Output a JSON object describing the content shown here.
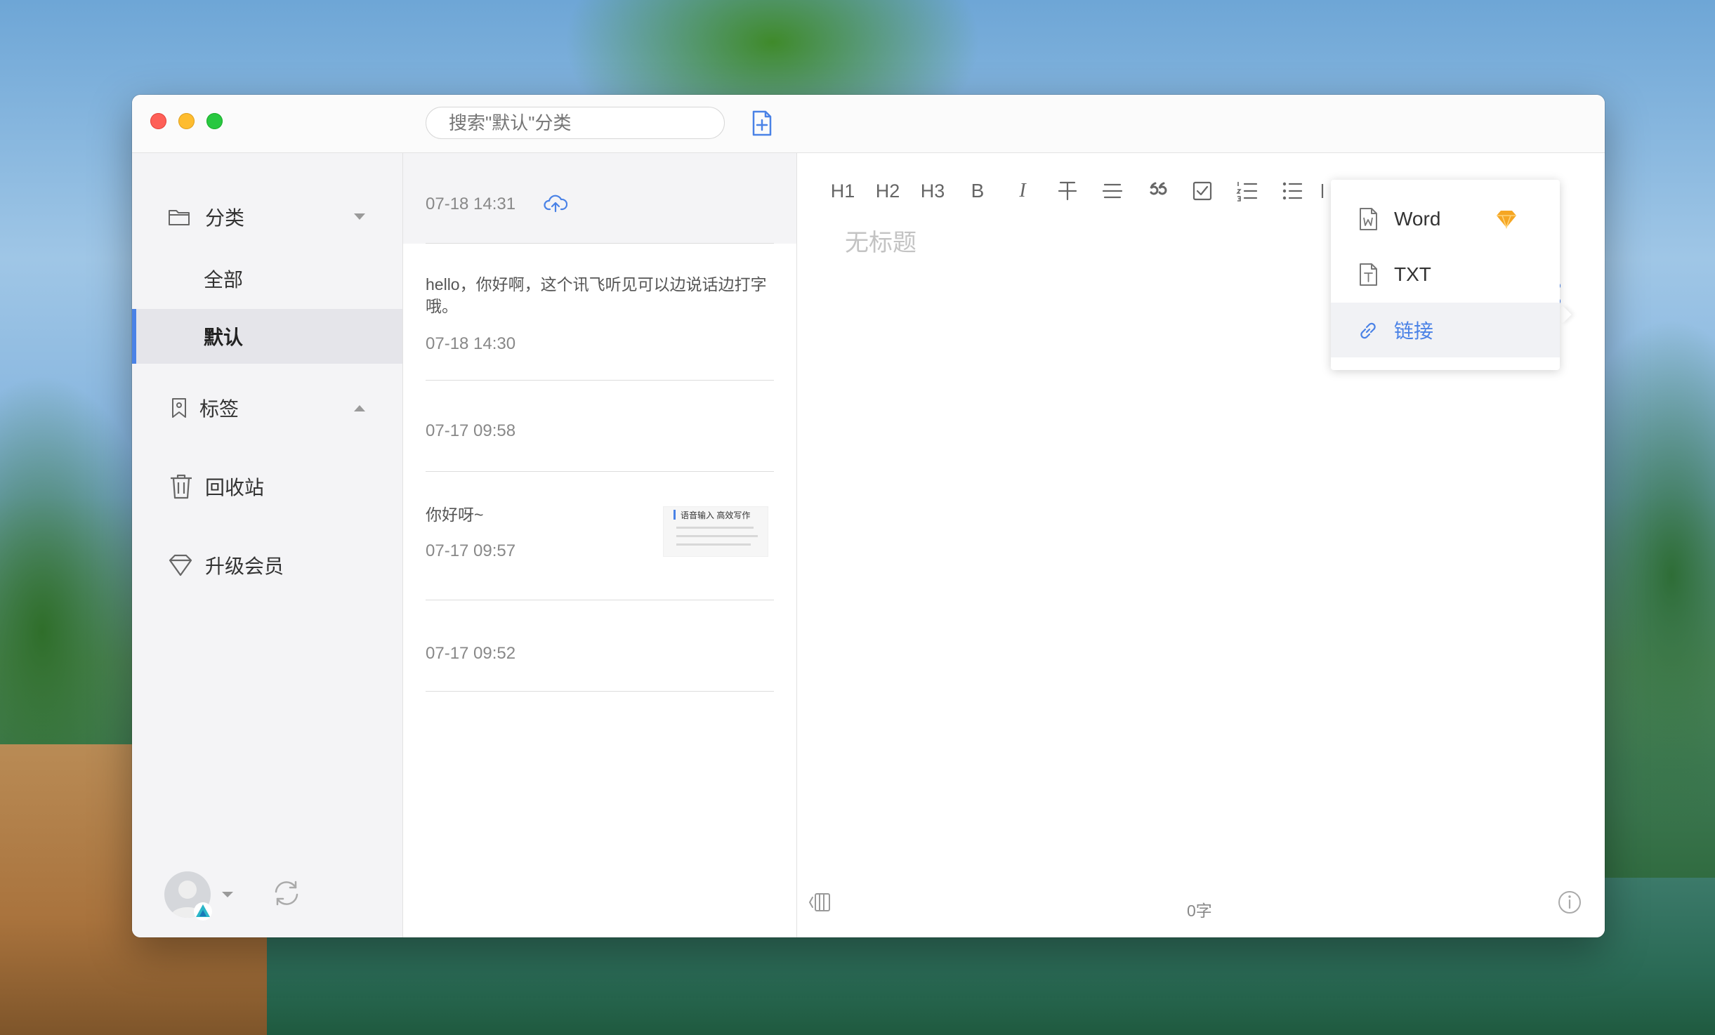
{
  "search": {
    "placeholder": "搜索\"默认\"分类"
  },
  "sidebar": {
    "category_header": "分类",
    "items": [
      {
        "label": "全部"
      },
      {
        "label": "默认"
      }
    ],
    "tags_header": "标签",
    "trash": "回收站",
    "upgrade": "升级会员"
  },
  "notes": [
    {
      "snippet": "",
      "time": "07-18 14:31"
    },
    {
      "snippet": "hello，你好啊，这个讯飞听见可以边说话边打字哦。",
      "time": "07-18 14:30"
    },
    {
      "snippet": "",
      "time": "07-17 09:58"
    },
    {
      "snippet": "你好呀~",
      "time": "07-17 09:57",
      "thumb_title": "语音输入 高效写作"
    },
    {
      "snippet": "",
      "time": "07-17 09:52"
    }
  ],
  "editor": {
    "toolbar": [
      "H1",
      "H2",
      "H3",
      "B",
      "I"
    ],
    "title_placeholder": "无标题",
    "word_count": "0字"
  },
  "share_menu": {
    "items": [
      {
        "label": "Word",
        "icon": "word-file-icon"
      },
      {
        "label": "TXT",
        "icon": "txt-file-icon"
      },
      {
        "label": "链接",
        "icon": "link-icon"
      }
    ]
  },
  "colors": {
    "accent": "#4a82e6",
    "premium": "#f5a623"
  }
}
